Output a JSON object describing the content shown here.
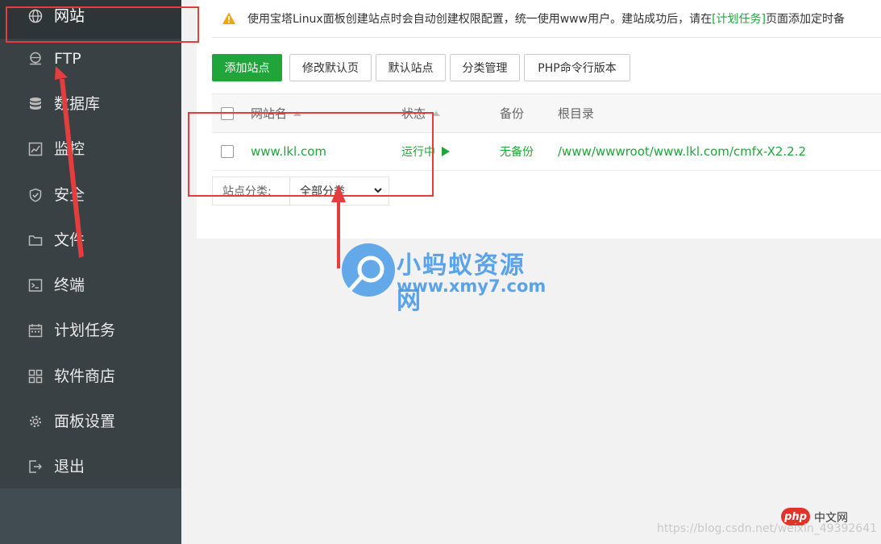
{
  "sidebar": {
    "items": [
      {
        "label": "网站",
        "icon": "globe-icon",
        "active": true
      },
      {
        "label": "FTP",
        "icon": "ftp-icon"
      },
      {
        "label": "数据库",
        "icon": "database-icon"
      },
      {
        "label": "监控",
        "icon": "monitor-chart-icon"
      },
      {
        "label": "安全",
        "icon": "shield-icon"
      },
      {
        "label": "文件",
        "icon": "folder-icon"
      },
      {
        "label": "终端",
        "icon": "terminal-icon"
      },
      {
        "label": "计划任务",
        "icon": "calendar-icon"
      },
      {
        "label": "软件商店",
        "icon": "grid-apps-icon"
      },
      {
        "label": "面板设置",
        "icon": "gear-icon"
      },
      {
        "label": "退出",
        "icon": "logout-icon"
      }
    ]
  },
  "notice": {
    "icon": "warning-icon",
    "text_before": "使用宝塔Linux面板创建站点时会自动创建权限配置，统一使用www用户。建站成功后，请在",
    "link": "[计划任务]",
    "text_after": "页面添加定时备"
  },
  "toolbar": {
    "add_site": "添加站点",
    "edit_default_page": "修改默认页",
    "default_site": "默认站点",
    "category_manage": "分类管理",
    "php_cli_version": "PHP命令行版本"
  },
  "table": {
    "headers": {
      "name": "网站名",
      "status": "状态",
      "backup": "备份",
      "root": "根目录"
    },
    "rows": [
      {
        "name": "www.lkl.com",
        "status": "运行中",
        "backup": "无备份",
        "root": "/www/wwwroot/www.lkl.com/cmfx-X2.2.2"
      }
    ]
  },
  "filter": {
    "label": "站点分类:",
    "selected": "全部分类"
  },
  "watermark": {
    "title": "小蚂蚁资源网",
    "url": "www.xmy7.com"
  },
  "footer": {
    "php_logo": "php",
    "php_site": "中文网",
    "csdn": "https://blog.csdn.net/weixin_49392641"
  },
  "colors": {
    "accent": "#20a53a",
    "sidebar": "#394145",
    "annotation": "#e33d3d",
    "watermark": "#4a9be8"
  }
}
